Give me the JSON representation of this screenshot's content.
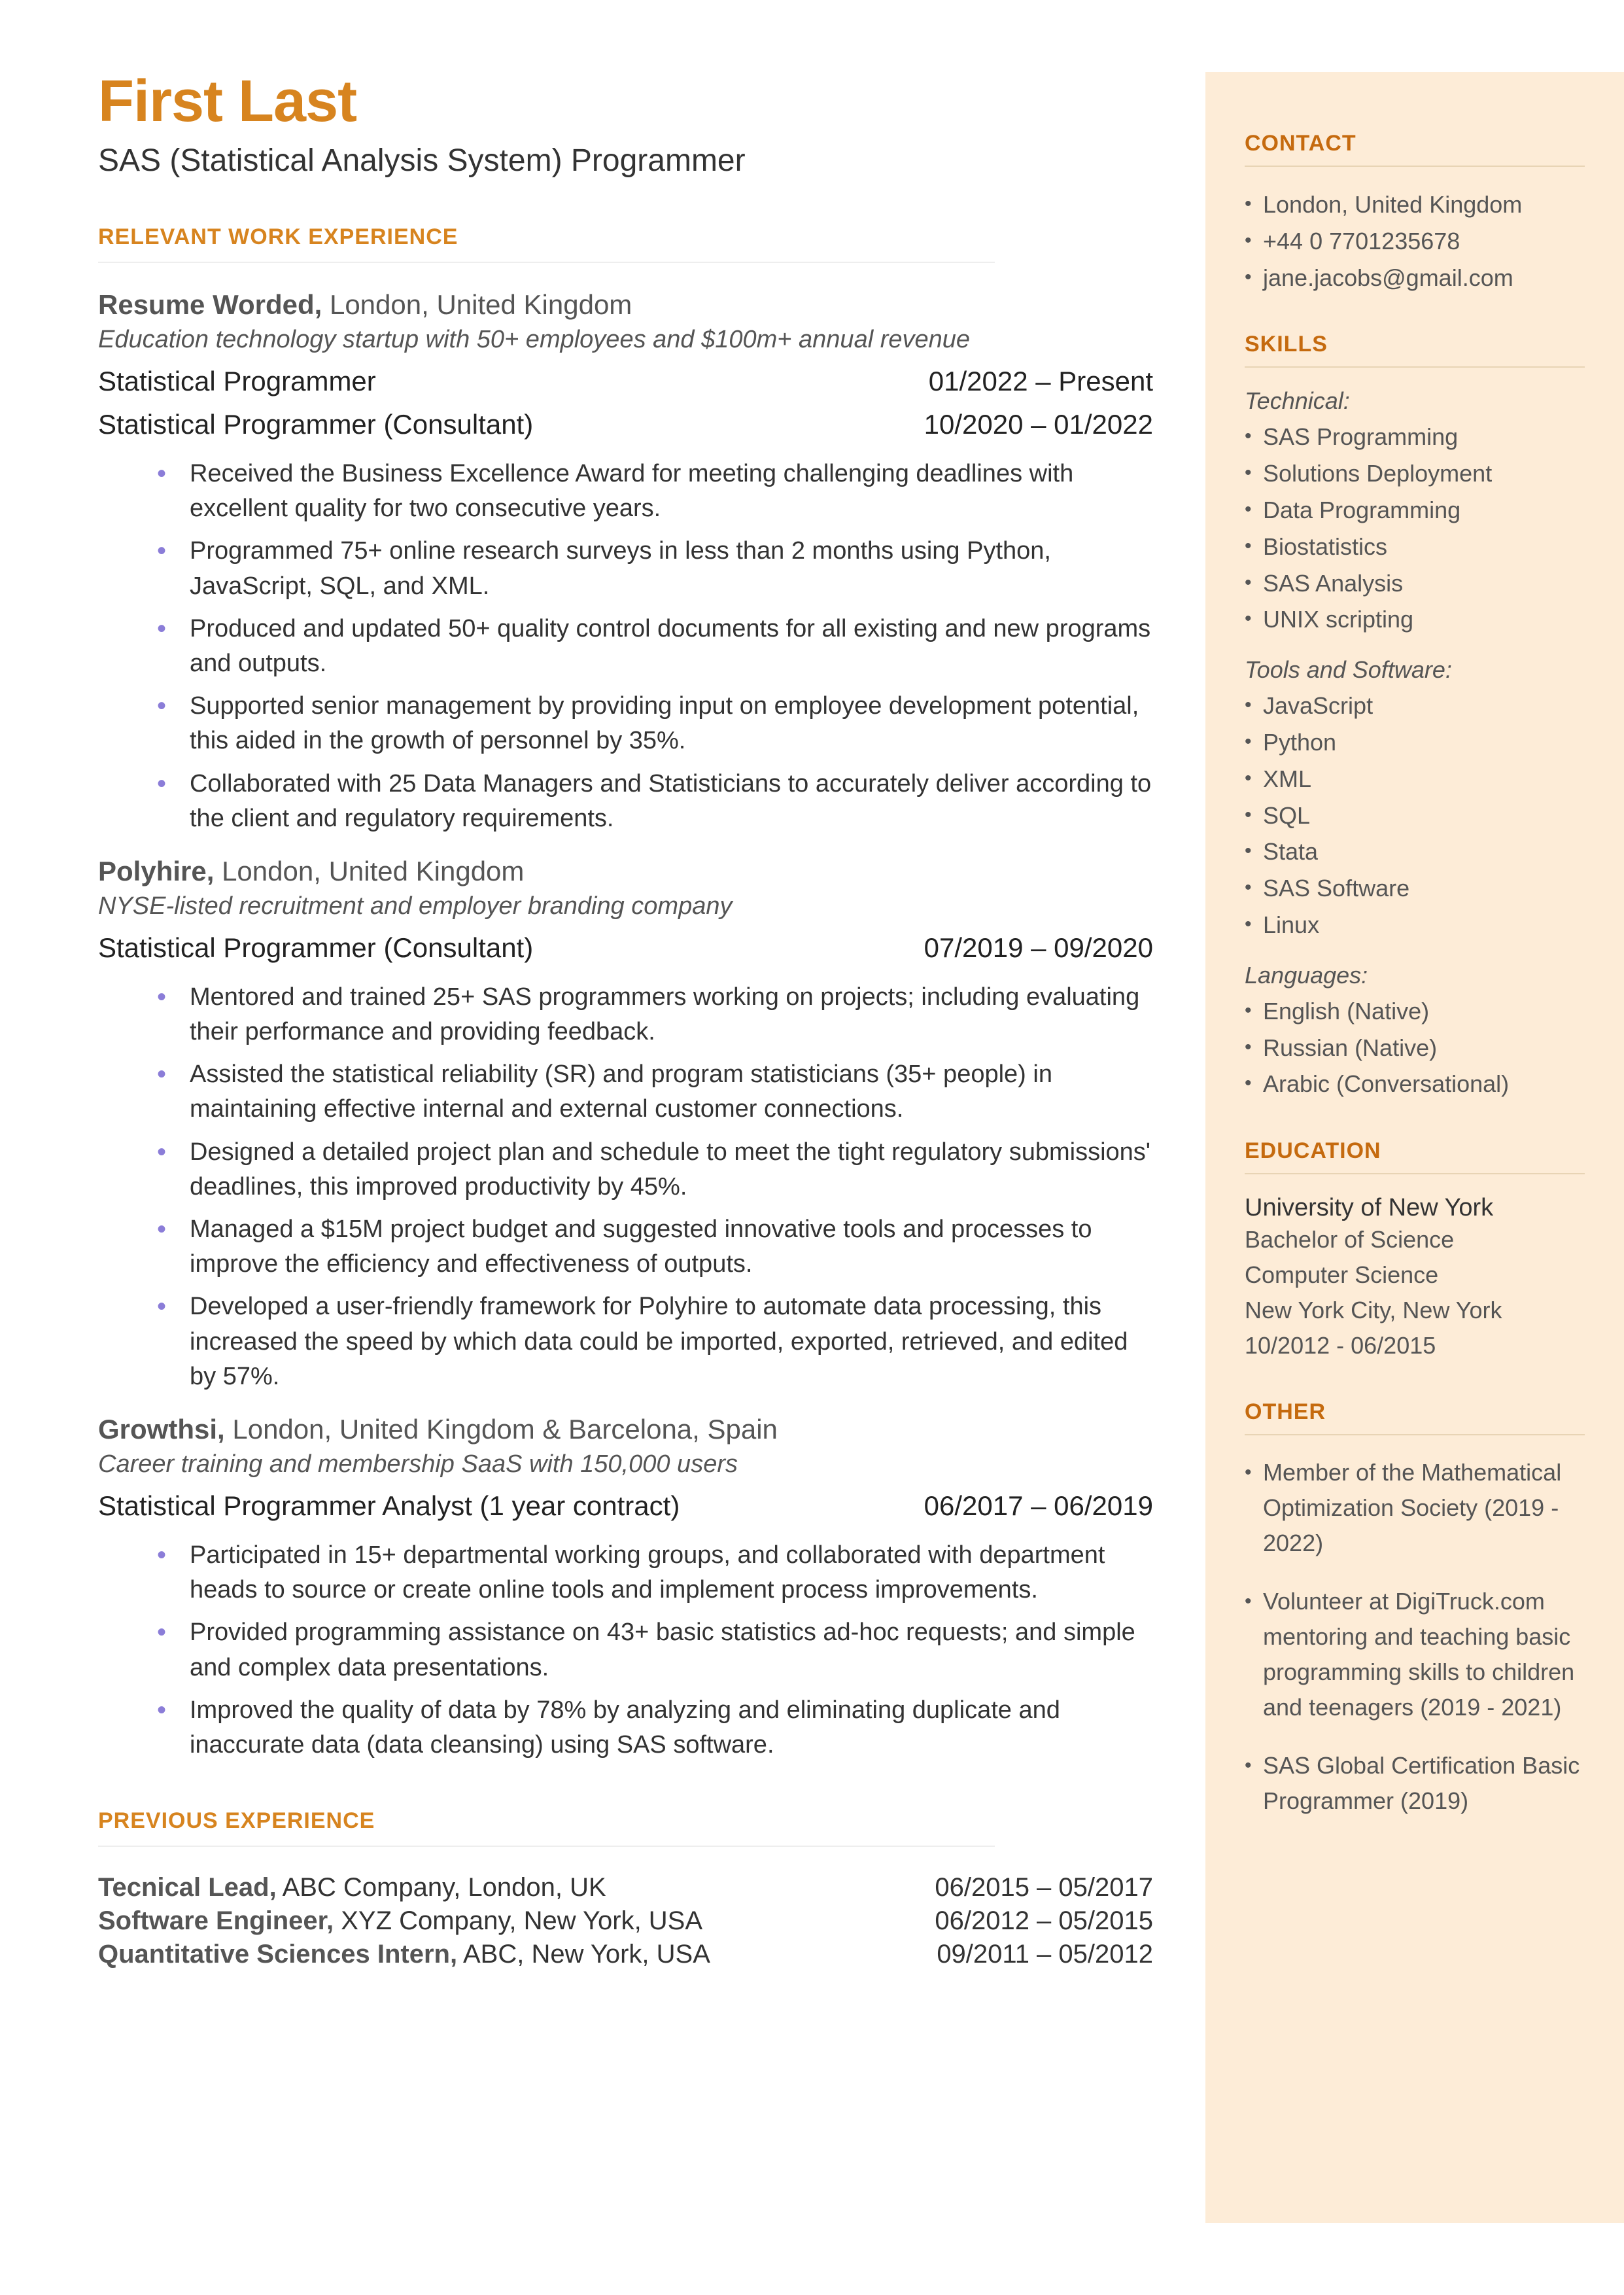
{
  "name": "First Last",
  "title": "SAS (Statistical Analysis System) Programmer",
  "sections": {
    "experience_header": "RELEVANT WORK EXPERIENCE",
    "previous_header": "PREVIOUS EXPERIENCE",
    "contact_header": "CONTACT",
    "skills_header": "SKILLS",
    "education_header": "EDUCATION",
    "other_header": "OTHER"
  },
  "jobs": [
    {
      "company": "Resume Worded,",
      "location": " London, United Kingdom",
      "desc": "Education technology startup with 50+ employees and $100m+ annual revenue",
      "roles": [
        {
          "title": "Statistical Programmer",
          "dates": "01/2022 – Present"
        },
        {
          "title": "Statistical Programmer (Consultant)",
          "dates": "10/2020 – 01/2022"
        }
      ],
      "bullets": [
        "Received the Business Excellence Award for meeting challenging deadlines with excellent quality for two consecutive years.",
        "Programmed 75+ online research surveys in less than 2 months using Python, JavaScript, SQL, and XML.",
        "Produced and updated 50+ quality control documents for all existing and new programs and outputs.",
        "Supported senior management by providing input on employee development potential, this aided in the growth of personnel by 35%.",
        "Collaborated with 25 Data Managers and Statisticians to accurately deliver according to the client and regulatory requirements."
      ]
    },
    {
      "company": "Polyhire,",
      "location": " London, United Kingdom",
      "desc": "NYSE-listed recruitment and employer branding company",
      "roles": [
        {
          "title": "Statistical Programmer (Consultant)",
          "dates": "07/2019 – 09/2020"
        }
      ],
      "bullets": [
        "Mentored and trained 25+ SAS programmers working on projects; including evaluating their performance and providing feedback.",
        "Assisted the statistical reliability (SR) and program statisticians (35+ people) in maintaining effective internal and external customer connections.",
        "Designed a detailed project plan and schedule to meet the tight regulatory submissions' deadlines, this improved productivity by 45%.",
        "Managed a $15M project budget and suggested innovative tools and processes to improve the efficiency and effectiveness of outputs.",
        "Developed a user-friendly framework for Polyhire to automate data processing, this increased the speed by which data could be imported, exported, retrieved, and edited by 57%."
      ]
    },
    {
      "company": "Growthsi,",
      "location": " London, United Kingdom & Barcelona, Spain",
      "desc": "Career training and membership SaaS with 150,000 users",
      "roles": [
        {
          "title": "Statistical Programmer Analyst (1 year contract)",
          "dates": "06/2017 – 06/2019"
        }
      ],
      "bullets": [
        "Participated in 15+ departmental working groups, and collaborated with department heads to source or create online tools and implement process improvements.",
        "Provided programming assistance on 43+ basic statistics ad-hoc requests; and simple and complex data presentations.",
        "Improved the quality of data by 78% by analyzing and eliminating duplicate and inaccurate data (data cleansing) using SAS software."
      ]
    }
  ],
  "previous": [
    {
      "title": "Tecnical Lead,",
      "rest": " ABC Company, London, UK",
      "dates": "06/2015 – 05/2017"
    },
    {
      "title": "Software Engineer,",
      "rest": " XYZ Company, New York, USA",
      "dates": "06/2012 – 05/2015"
    },
    {
      "title": "Quantitative Sciences Intern,",
      "rest": " ABC, New York, USA",
      "dates": "09/2011 – 05/2012"
    }
  ],
  "contact": [
    "London, United Kingdom",
    "+44 0 7701235678",
    "jane.jacobs@gmail.com"
  ],
  "skills": {
    "technical_label": "Technical:",
    "technical": [
      "SAS Programming",
      "Solutions Deployment",
      "Data Programming",
      "Biostatistics",
      "SAS Analysis",
      "UNIX scripting"
    ],
    "tools_label": "Tools and Software:",
    "tools": [
      "JavaScript",
      "Python",
      "XML",
      "SQL",
      "Stata",
      "SAS Software",
      "Linux"
    ],
    "languages_label": "Languages:",
    "languages": [
      "English (Native)",
      "Russian (Native)",
      "Arabic (Conversational)"
    ]
  },
  "education": {
    "school": "University of New York",
    "degree": "Bachelor of Science",
    "major": "Computer Science",
    "loc": "New York City, New York",
    "dates": "10/2012 - 06/2015"
  },
  "other": [
    "Member of the Mathematical Optimization Society (2019 - 2022)",
    "Volunteer at DigiTruck.com mentoring and teaching basic programming skills to children and teenagers (2019 - 2021)",
    "SAS Global Certification Basic Programmer (2019)"
  ]
}
